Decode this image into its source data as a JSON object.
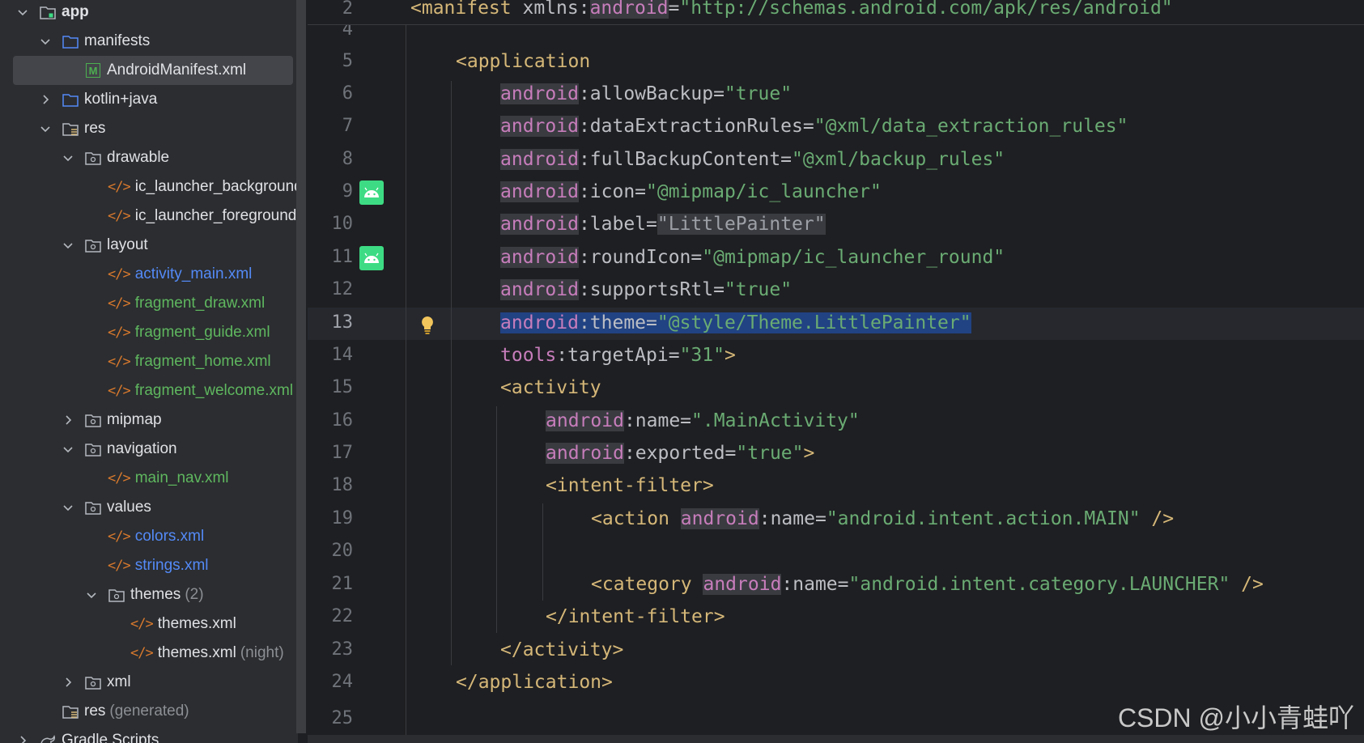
{
  "tree": {
    "rows": [
      {
        "label": "app"
      },
      {
        "label": "manifests"
      },
      {
        "label": "AndroidManifest.xml"
      },
      {
        "label": "kotlin+java"
      },
      {
        "label": "res"
      },
      {
        "label": "drawable"
      },
      {
        "label": "ic_launcher_background.xml"
      },
      {
        "label": "ic_launcher_foreground.xml"
      },
      {
        "label": "layout"
      },
      {
        "label": "activity_main.xml"
      },
      {
        "label": "fragment_draw.xml"
      },
      {
        "label": "fragment_guide.xml"
      },
      {
        "label": "fragment_home.xml"
      },
      {
        "label": "fragment_welcome.xml"
      },
      {
        "label": "mipmap"
      },
      {
        "label": "navigation"
      },
      {
        "label": "main_nav.xml"
      },
      {
        "label": "values"
      },
      {
        "label": "colors.xml"
      },
      {
        "label": "strings.xml"
      },
      {
        "label": "themes",
        "hint": "(2)"
      },
      {
        "label": "themes.xml"
      },
      {
        "label": "themes.xml",
        "hint": "(night)"
      },
      {
        "label": "xml"
      },
      {
        "label": "res",
        "hint": "(generated)"
      },
      {
        "label": "Gradle Scripts"
      }
    ]
  },
  "editor": {
    "sticky_line_number": "2",
    "sticky_line": {
      "tag": "<manifest",
      "attr": " xmlns:",
      "ns": "android",
      "eq": "=",
      "value": "\"http://schemas.android.com/apk/res/android\""
    },
    "line_numbers": [
      "4",
      "5",
      "6",
      "7",
      "8",
      "9",
      "10",
      "11",
      "12",
      "13",
      "14",
      "15",
      "16",
      "17",
      "18",
      "19",
      "20",
      "21",
      "22",
      "23",
      "24",
      "25"
    ],
    "lines": {
      "l5": {
        "tag": "<application"
      },
      "l6": {
        "ns": "android",
        "attr": ":allowBackup=",
        "value": "\"true\""
      },
      "l7": {
        "ns": "android",
        "attr": ":dataExtractionRules=",
        "value": "\"@xml/data_extraction_rules\""
      },
      "l8": {
        "ns": "android",
        "attr": ":fullBackupContent=",
        "value": "\"@xml/backup_rules\""
      },
      "l9": {
        "ns": "android",
        "attr": ":icon=",
        "value": "\"@mipmap/ic_launcher\""
      },
      "l10": {
        "ns": "android",
        "attr": ":label=",
        "value": "\"LittlePainter\""
      },
      "l11": {
        "ns": "android",
        "attr": ":roundIcon=",
        "value": "\"@mipmap/ic_launcher_round\""
      },
      "l12": {
        "ns": "android",
        "attr": ":supportsRtl=",
        "value": "\"true\""
      },
      "l13": {
        "ns": "android",
        "attr": ":theme=",
        "value": "\"@style/Theme.LittlePainter\""
      },
      "l14": {
        "ns": "tools",
        "attr": ":targetApi=",
        "value": "\"31\"",
        "close": ">"
      },
      "l15": {
        "tag": "<activity"
      },
      "l16": {
        "ns": "android",
        "attr": ":name=",
        "value": "\".MainActivity\""
      },
      "l17": {
        "ns": "android",
        "attr": ":exported=",
        "value": "\"true\"",
        "close": ">"
      },
      "l18": {
        "tag": "<intent-filter>"
      },
      "l19": {
        "tag": "<action",
        "ns": "android",
        "attr": ":name=",
        "value": "\"android.intent.action.MAIN\"",
        "close": " />"
      },
      "l21": {
        "tag": "<category",
        "ns": "android",
        "attr": ":name=",
        "value": "\"android.intent.category.LAUNCHER\"",
        "close": " />"
      },
      "l22": {
        "tag": "</intent-filter>"
      },
      "l23": {
        "tag": "</activity>"
      },
      "l24": {
        "tag": "</application>"
      }
    }
  },
  "watermark": "CSDN @小小青蛙吖",
  "icons": [
    "chevron-down-icon",
    "chevron-right-icon",
    "folder-icon",
    "res-folder-icon",
    "module-icon",
    "manifest-icon",
    "xml-code-icon",
    "android-icon",
    "lightbulb-icon"
  ],
  "colors": {
    "tag": "#d5b778",
    "namespace": "#c77dbb",
    "string": "#6aab73",
    "selection": "#214283",
    "android_green": "#3ddc84",
    "file_green": "#5fb75f",
    "file_blue": "#548af7"
  }
}
